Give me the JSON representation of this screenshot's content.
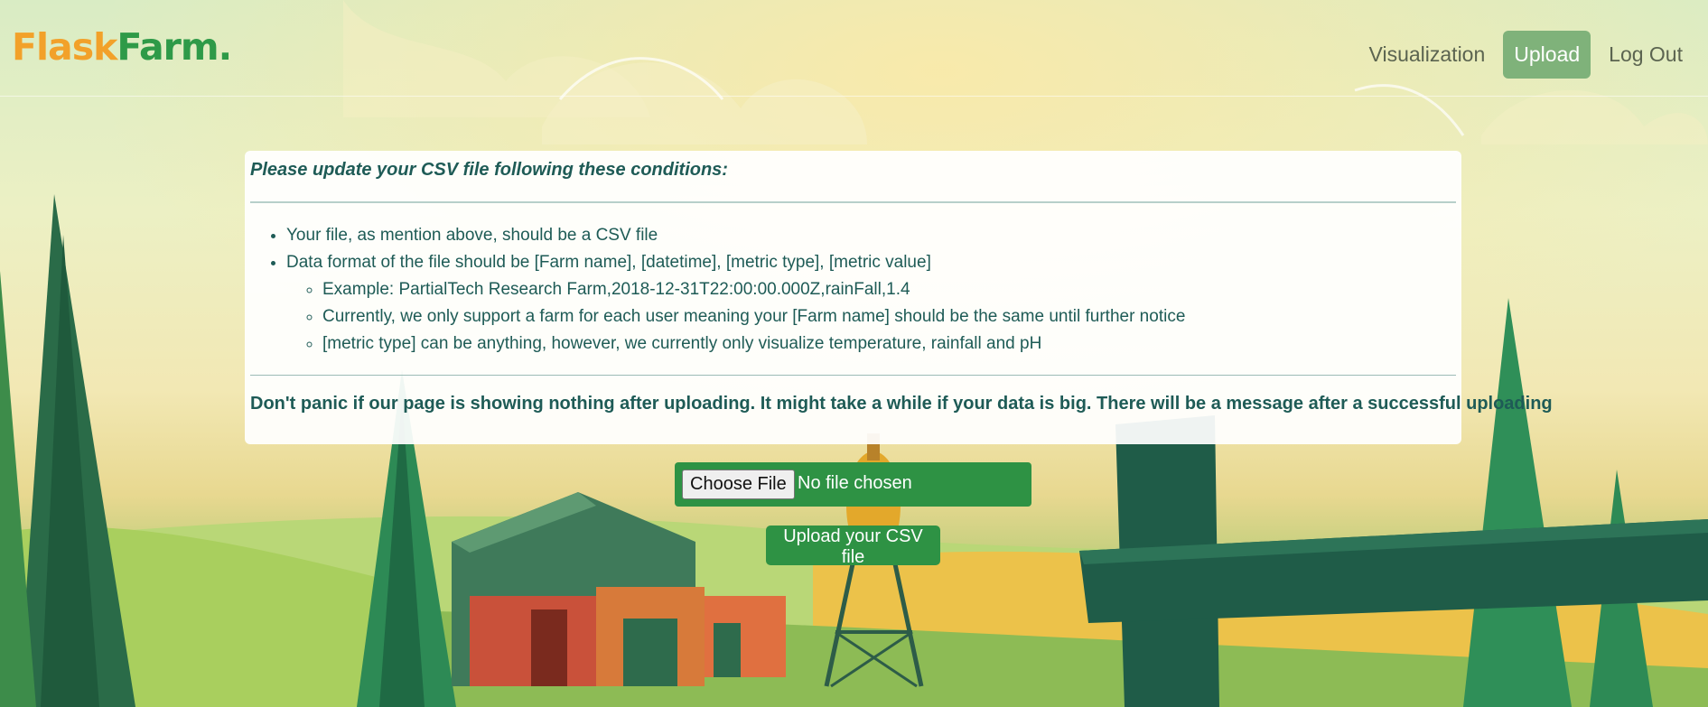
{
  "brand": {
    "part1": "Flask",
    "part2": "Farm."
  },
  "nav": {
    "items": [
      {
        "label": "Visualization",
        "active": false
      },
      {
        "label": "Upload",
        "active": true
      },
      {
        "label": "Log Out",
        "active": false
      }
    ]
  },
  "panel": {
    "heading": "Please update your CSV file following these conditions:",
    "conditions": [
      "Your file, as mention above, should be a CSV file",
      "Data format of the file should be [Farm name], [datetime], [metric type], [metric value]"
    ],
    "sub_conditions": [
      "Example: PartialTech Research Farm,2018-12-31T22:00:00.000Z,rainFall,1.4",
      "Currently, we only support a farm for each user meaning your [Farm name] should be the same until further notice",
      "[metric type] can be anything, however, we currently only visualize temperature, rainfall and pH"
    ],
    "notice": "Don't panic if our page is showing nothing after uploading. It might take a while if your data is big. There will be a message after a successful uploading"
  },
  "upload": {
    "choose_file_label": "Choose File",
    "file_status": "No file chosen",
    "submit_label": "Upload your CSV file"
  },
  "colors": {
    "brand_orange": "#f2a12a",
    "brand_green": "#2e9a48",
    "button_green": "#2e9244",
    "active_nav": "#7fb27a",
    "text_teal": "#1e5b56"
  }
}
